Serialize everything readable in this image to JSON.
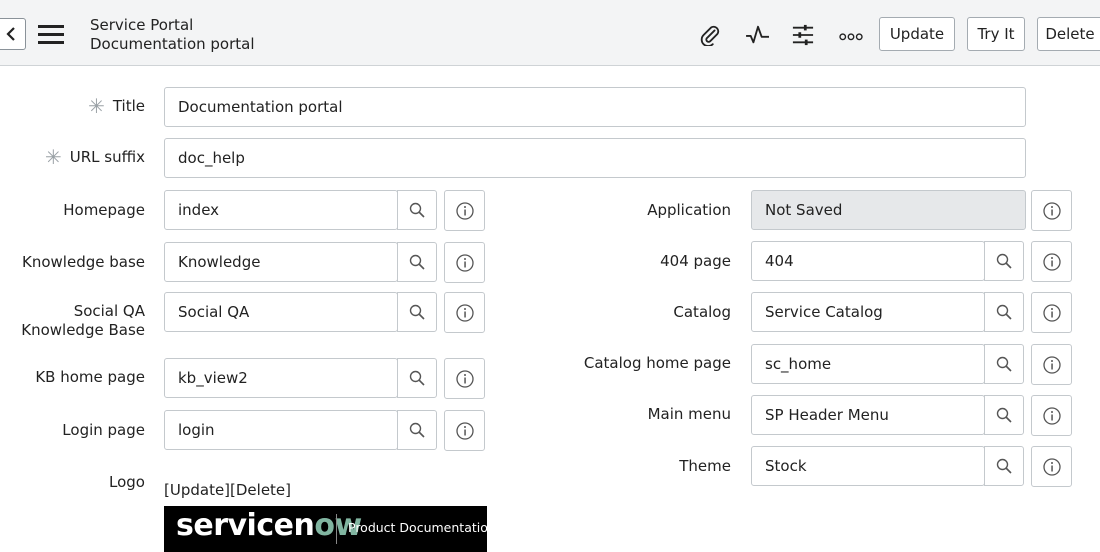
{
  "header": {
    "title": "Service Portal",
    "subtitle": "Documentation portal",
    "buttons": {
      "update": "Update",
      "try_it": "Try It",
      "delete": "Delete"
    },
    "icons": [
      "back-icon",
      "menu-icon",
      "paperclip-icon",
      "activity-icon",
      "sliders-icon",
      "more-icon"
    ]
  },
  "form": {
    "title": {
      "label": "Title",
      "value": "Documentation portal",
      "required": true
    },
    "url_suffix": {
      "label": "URL suffix",
      "value": "doc_help",
      "required": true
    },
    "homepage": {
      "label": "Homepage",
      "value": "index"
    },
    "knowledge_base": {
      "label": "Knowledge base",
      "value": "Knowledge"
    },
    "social_qa_kb": {
      "label_line1": "Social QA",
      "label_line2": "Knowledge Base",
      "value": "Social QA"
    },
    "kb_home_page": {
      "label": "KB home page",
      "value": "kb_view2"
    },
    "login_page": {
      "label": "Login page",
      "value": "login"
    },
    "logo": {
      "label": "Logo",
      "actions": "[Update][Delete]",
      "image_word_main": "servicen",
      "image_word_accent": "ow",
      "image_caption": "Product Documentation"
    },
    "application": {
      "label": "Application",
      "value": "Not Saved"
    },
    "page_404": {
      "label": "404 page",
      "value": "404"
    },
    "catalog": {
      "label": "Catalog",
      "value": "Service Catalog"
    },
    "catalog_home_page": {
      "label": "Catalog home page",
      "value": "sc_home"
    },
    "main_menu": {
      "label": "Main menu",
      "value": "SP Header Menu"
    },
    "theme": {
      "label": "Theme",
      "value": "Stock"
    }
  },
  "colors": {
    "header_bg": "#f3f4f5",
    "readonly_bg": "#e6e8ea",
    "logo_accent": "#81b5a1"
  }
}
